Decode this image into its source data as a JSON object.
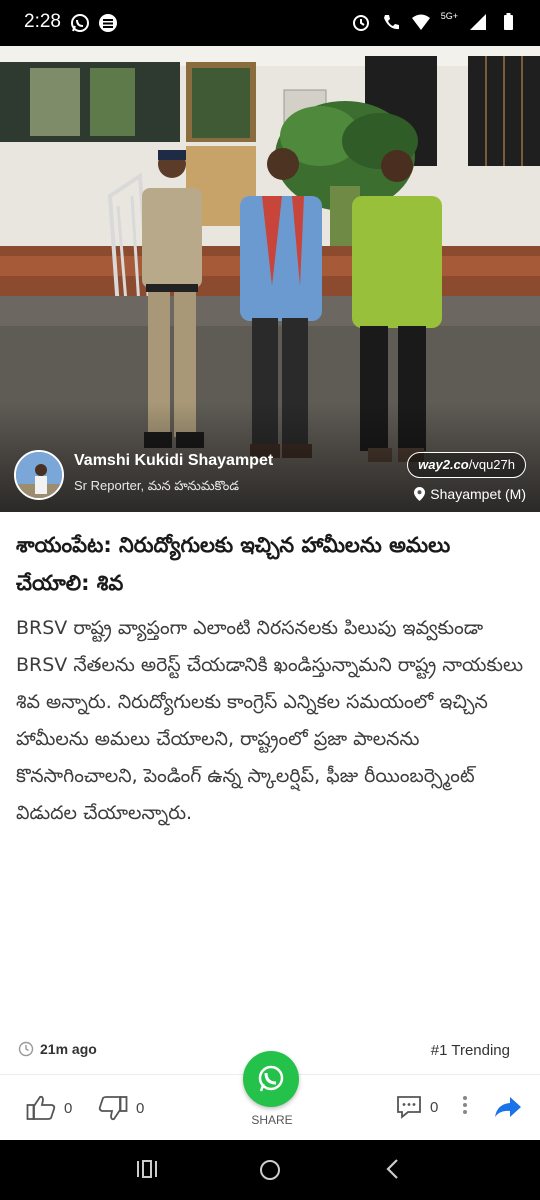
{
  "status_bar": {
    "time": "2:28",
    "network": "5G+",
    "left_icons": [
      "whatsapp-icon",
      "app-icon"
    ],
    "right_icons": [
      "alarm-icon",
      "volte-call-icon",
      "wifi-icon",
      "signal-icon",
      "battery-icon"
    ]
  },
  "post": {
    "author_name": "Vamshi Kukidi Shayampet",
    "author_role": "Sr Reporter, మన హనుమకొండ",
    "short_link_brand": "way2.co",
    "short_link_path": "/vqu27h",
    "location": "Shayampet (M)"
  },
  "article": {
    "headline": "శాయంపేట: నిరుద్యోగులకు ఇచ్చిన హామీలను అమలు చేయాలి: శివ",
    "body": "BRSV రాష్ట్ర వ్యాప్తంగా ఎలాంటి నిరసనలకు పిలుపు ఇవ్వకుండా BRSV నేతలను అరెస్ట్ చేయడానికి ఖండిస్తున్నామని రాష్ట్ర నాయకులు శివ అన్నారు. నిరుద్యోగులకు కాంగ్రెస్ ఎన్నికల సమయంలో ఇచ్చిన హామీలను అమలు చేయాలని, రాష్ట్రంలో ప్రజా పాలనను కొనసాగించాలని, పెండింగ్ ఉన్న స్కాలర్షిప్, ఫీజు రీయింబర్స్మెంట్ విడుదల చేయాలన్నారు.",
    "time_ago": "21m ago",
    "trending": "#1 Trending"
  },
  "actions": {
    "likes": "0",
    "dislikes": "0",
    "share_label": "SHARE",
    "comments": "0"
  },
  "colors": {
    "share_green": "#25c24b",
    "forward_blue": "#1a73e8"
  }
}
